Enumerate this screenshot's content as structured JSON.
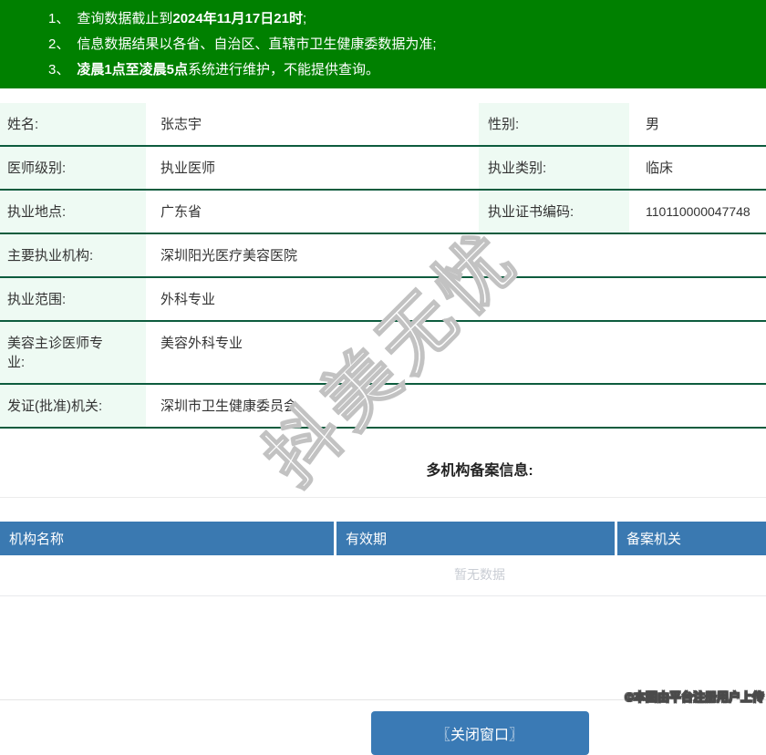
{
  "banner": {
    "line1_num": "1、",
    "line1_pre": "查询数据截止到",
    "line1_bold": "2024年11月17日21时",
    "line1_post": ";",
    "line2_num": "2、",
    "line2_text": "信息数据结果以各省、自治区、直辖市卫生健康委数据为准;",
    "line3_num": "3、",
    "line3_bold": "凌晨1点至凌晨5点",
    "line3_post": "系统进行维护，不能提供查询。"
  },
  "info": {
    "rows2col": [
      {
        "label1": "姓名:",
        "value1": "张志宇",
        "label2": "性别:",
        "value2": "男"
      },
      {
        "label1": "医师级别:",
        "value1": "执业医师",
        "label2": "执业类别:",
        "value2": "临床"
      },
      {
        "label1": "执业地点:",
        "value1": "广东省",
        "label2": "执业证书编码:",
        "value2": "110110000047748"
      }
    ],
    "rows1col": [
      {
        "label": "主要执业机构:",
        "value": "深圳阳光医疗美容医院"
      },
      {
        "label": "执业范围:",
        "value": "外科专业"
      },
      {
        "label": "美容主诊医师专业:",
        "value": "美容外科专业"
      },
      {
        "label": "发证(批准)机关:",
        "value": "深圳市卫生健康委员会"
      }
    ]
  },
  "section": {
    "title": "多机构备案信息:"
  },
  "org_table": {
    "headers": [
      "机构名称",
      "有效期",
      "备案机关"
    ],
    "empty_text": "暂无数据"
  },
  "footer": {
    "close_button": "〖关闭窗口〗"
  },
  "watermark": {
    "diagonal": "抖美无忧",
    "corner": "©本图由平台注册用户上传"
  },
  "colors": {
    "banner_green": "#008000",
    "border_green": "#0d5c3e",
    "label_bg": "#eefaf3",
    "header_blue": "#3a79b1",
    "button_blue": "#3a7ab5"
  }
}
